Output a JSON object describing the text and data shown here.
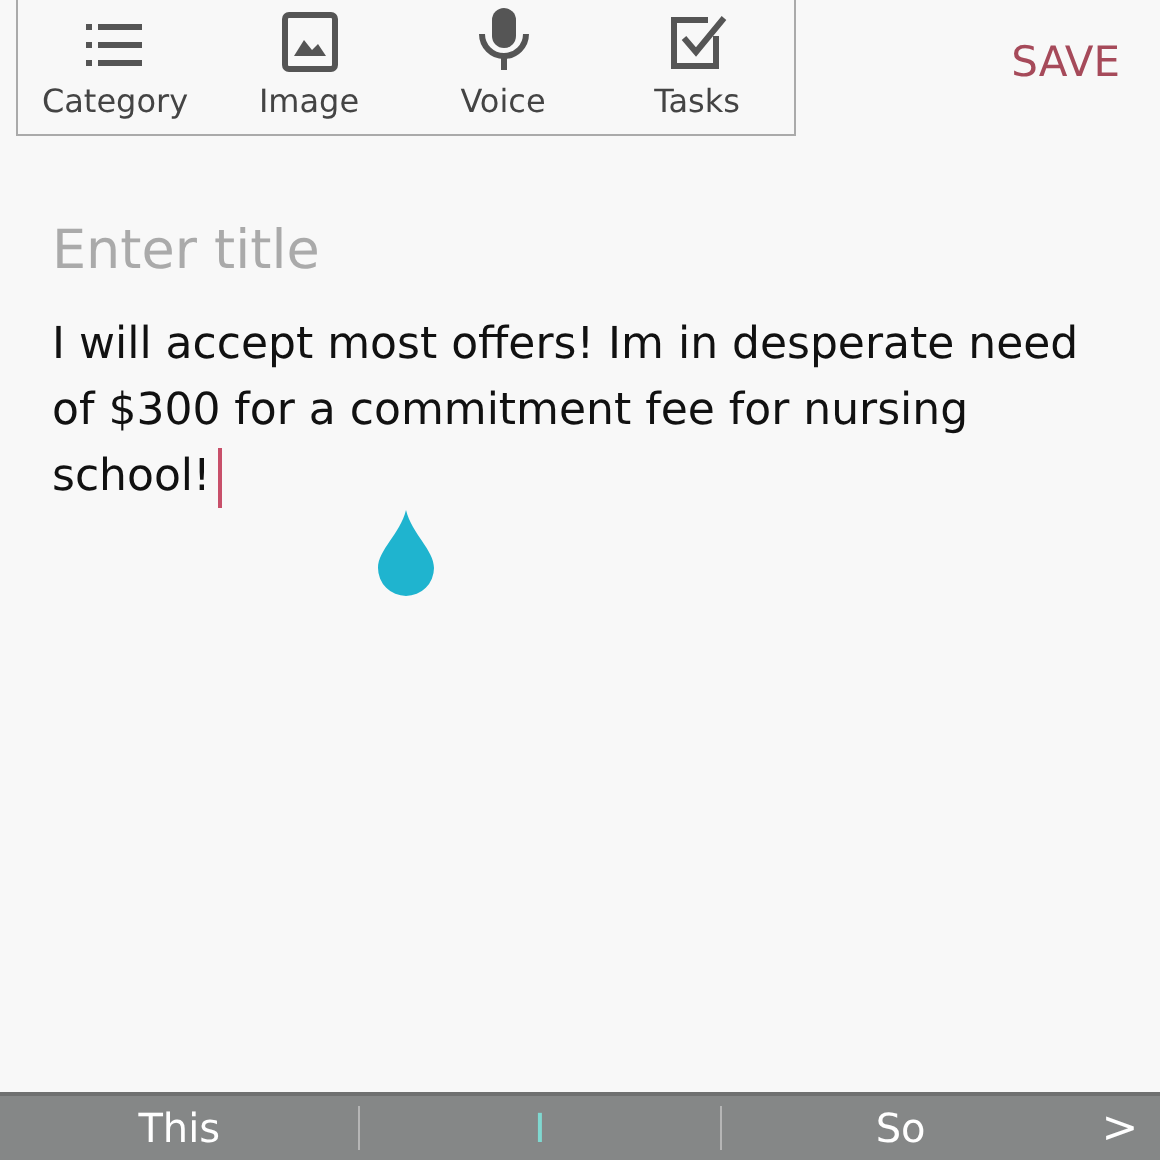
{
  "toolbar": [
    {
      "kind": "category",
      "label": "Category"
    },
    {
      "kind": "image",
      "label": "Image"
    },
    {
      "kind": "voice",
      "label": "Voice"
    },
    {
      "kind": "tasks",
      "label": "Tasks"
    }
  ],
  "save": "SAVE",
  "title": {
    "placeholder": "Enter title"
  },
  "body": "I will accept most offers! Im in desperate need of $300 for a commitment fee for nursing school!",
  "suggestions": [
    {
      "text": "This",
      "selected": false
    },
    {
      "text": "I",
      "selected": true
    },
    {
      "text": "So",
      "selected": false
    }
  ],
  "more": ">"
}
